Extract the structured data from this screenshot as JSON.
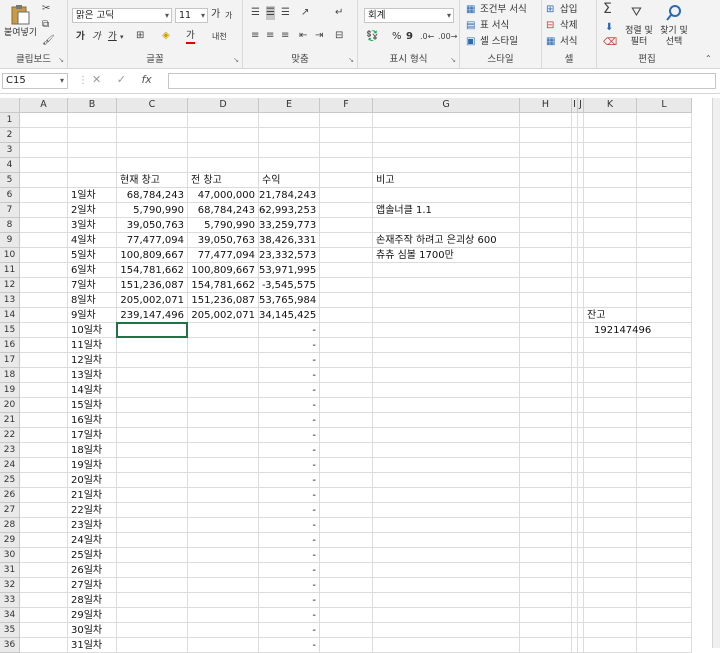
{
  "ribbon": {
    "clipboard": {
      "paste_label": "붙여넣기",
      "title": "클립보드"
    },
    "font": {
      "name": "맑은 고딕",
      "size": "11",
      "grow": "가",
      "shrink": "가",
      "bold": "가",
      "italic": "가",
      "underline": "가",
      "fontcolor": "가",
      "phonetic": "내천",
      "title": "글꼴"
    },
    "align": {
      "title": "맞춤"
    },
    "number": {
      "format": "회계",
      "pct": "%",
      "comma": "9",
      "title": "표시 형식"
    },
    "styles": {
      "conditional": "조건부 서식",
      "table": "표 서식",
      "cell": "셀 스타일",
      "title": "스타일"
    },
    "cells": {
      "insert": "삽입",
      "delete": "삭제",
      "format": "서식",
      "title": "셀"
    },
    "editing": {
      "sort": "정렬 및 필터",
      "find": "찾기 및 선택",
      "title": "편집"
    }
  },
  "formula_bar": {
    "name_box": "C15",
    "fx": "fx",
    "cancel": "✕",
    "enter": "✓",
    "value": ""
  },
  "columns": [
    "A",
    "B",
    "C",
    "D",
    "E",
    "F",
    "G",
    "H",
    "I",
    "J",
    "K",
    "L"
  ],
  "rows": [
    "1",
    "2",
    "3",
    "4",
    "5",
    "6",
    "7",
    "8",
    "9",
    "10",
    "11",
    "12",
    "13",
    "14",
    "15",
    "16",
    "17",
    "18",
    "19",
    "20",
    "21",
    "22",
    "23",
    "24",
    "25",
    "26",
    "27",
    "28",
    "29",
    "30",
    "31",
    "32",
    "33",
    "34",
    "35",
    "36"
  ],
  "headers": {
    "current": "현재 창고",
    "previous": "전 창고",
    "profit": "수익",
    "note": "비고"
  },
  "days": [
    "1일차",
    "2일차",
    "3일차",
    "4일차",
    "5일차",
    "6일차",
    "7일차",
    "8일차",
    "9일차",
    "10일차",
    "11일차",
    "12일차",
    "13일차",
    "14일차",
    "15일차",
    "16일차",
    "17일차",
    "18일차",
    "19일차",
    "20일차",
    "21일차",
    "22일차",
    "23일차",
    "24일차",
    "25일차",
    "26일차",
    "27일차",
    "28일차",
    "29일차",
    "30일차",
    "31일차"
  ],
  "current": [
    "68,784,243",
    "5,790,990",
    "39,050,763",
    "77,477,094",
    "100,809,667",
    "154,781,662",
    "151,236,087",
    "205,002,071",
    "239,147,496"
  ],
  "previous": [
    "47,000,000",
    "68,784,243",
    "5,790,990",
    "39,050,763",
    "77,477,094",
    "100,809,667",
    "154,781,662",
    "151,236,087",
    "205,002,071"
  ],
  "profit": [
    "21,784,243",
    "62,993,253",
    "33,259,773",
    "38,426,331",
    "23,332,573",
    "53,971,995",
    "3,545,575",
    "53,765,984",
    "34,145,425"
  ],
  "profit_negative": [
    false,
    true,
    false,
    false,
    false,
    false,
    true,
    false,
    false
  ],
  "dash": "-",
  "notes": {
    "row7": "앱솔너클 1.1",
    "row9": "손재주작 하려고 은괴상 600",
    "row10": "츄츄 심볼 1700만"
  },
  "balance": {
    "label": "잔고",
    "value": "192147496"
  }
}
